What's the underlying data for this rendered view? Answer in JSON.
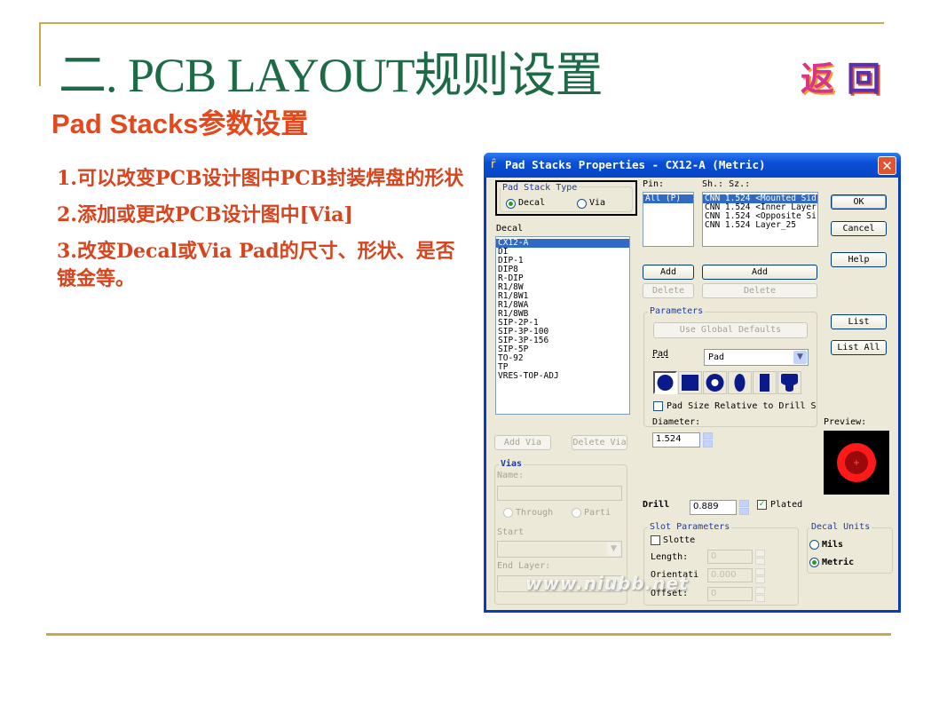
{
  "slide": {
    "title": "二. PCB LAYOUT规则设置",
    "subtitle": "Pad Stacks参数设置",
    "back_logo": [
      "返",
      "回"
    ],
    "bullets": [
      "1.可以改变PCB设计图中PCB封装焊盘的形状",
      "2.添加或更改PCB设计图中[Via]",
      "3.改变Decal或Via Pad的尺寸、形状、是否镀金等。"
    ],
    "watermark": "www.niubb.net"
  },
  "dialog": {
    "title": "Pad Stacks Properties - CX12-A (Metric)",
    "close_label": "✕",
    "pad_stack_type": {
      "legend": "Pad Stack Type",
      "options": [
        {
          "label": "Decal",
          "selected": true
        },
        {
          "label": "Via",
          "selected": false
        }
      ]
    },
    "decal": {
      "label": "Decal",
      "items": [
        "CX12-A",
        "DI",
        "DIP-1",
        "DIP8",
        "R-DIP",
        "R1/8W",
        "R1/8W1",
        "R1/8WA",
        "R1/8WB",
        "SIP-2P-1",
        "SIP-3P-100",
        "SIP-3P-156",
        "SIP-5P",
        "TO-92",
        "TP",
        "VRES-TOP-ADJ"
      ],
      "selected": "CX12-A"
    },
    "pin": {
      "label": "Pin:",
      "items": [
        "All (P)"
      ],
      "selected": "All (P)"
    },
    "shape_size": {
      "label": "Sh.:  Sz.:",
      "items": [
        "CNN 1.524 <Mounted Sid",
        "CNN 1.524 <Inner Layer",
        "CNN 1.524 <Opposite Si",
        "CNN 1.524 Layer_25"
      ],
      "selected": "CNN 1.524 <Mounted Sid"
    },
    "buttons": {
      "ok": "OK",
      "cancel": "Cancel",
      "help": "Help",
      "pin_add": "Add",
      "pin_delete": "Delete",
      "layer_add": "Add",
      "layer_delete": "Delete",
      "list": "List",
      "list_all": "List All",
      "add_via": "Add Via",
      "delete_via": "Delete Via"
    },
    "parameters": {
      "legend": "Parameters",
      "use_global_defaults": "Use Global Defaults",
      "pad_label": "Pad",
      "pad_select_value": "Pad",
      "shapes": [
        "round",
        "square",
        "annular",
        "oval",
        "rectangle",
        "odd"
      ],
      "active_shape": "round",
      "pad_size_relative_label": "Pad Size Relative to Drill S",
      "pad_size_relative_checked": false,
      "diameter_label": "Diameter:",
      "diameter_value": "1.524"
    },
    "preview_label": "Preview:",
    "drill": {
      "label": "Drill",
      "value": "0.889",
      "plated_label": "Plated",
      "plated_checked": true
    },
    "slot_parameters": {
      "legend": "Slot Parameters",
      "slotted_label": "Slotte",
      "slotted_checked": false,
      "length_label": "Length:",
      "length_value": "0",
      "orientation_label": "Orientati",
      "orientation_value": "0.000",
      "offset_label": "Offset:",
      "offset_value": "0"
    },
    "decal_units": {
      "legend": "Decal Units",
      "options": [
        {
          "label": "Mils",
          "selected": false
        },
        {
          "label": "Metric",
          "selected": true
        }
      ]
    },
    "vias": {
      "legend": "Vias",
      "name_label": "Name:",
      "name_value": "",
      "through_label": "Through",
      "partial_label": "Parti",
      "start_label": "Start",
      "end_layer_label": "End Layer:"
    }
  }
}
